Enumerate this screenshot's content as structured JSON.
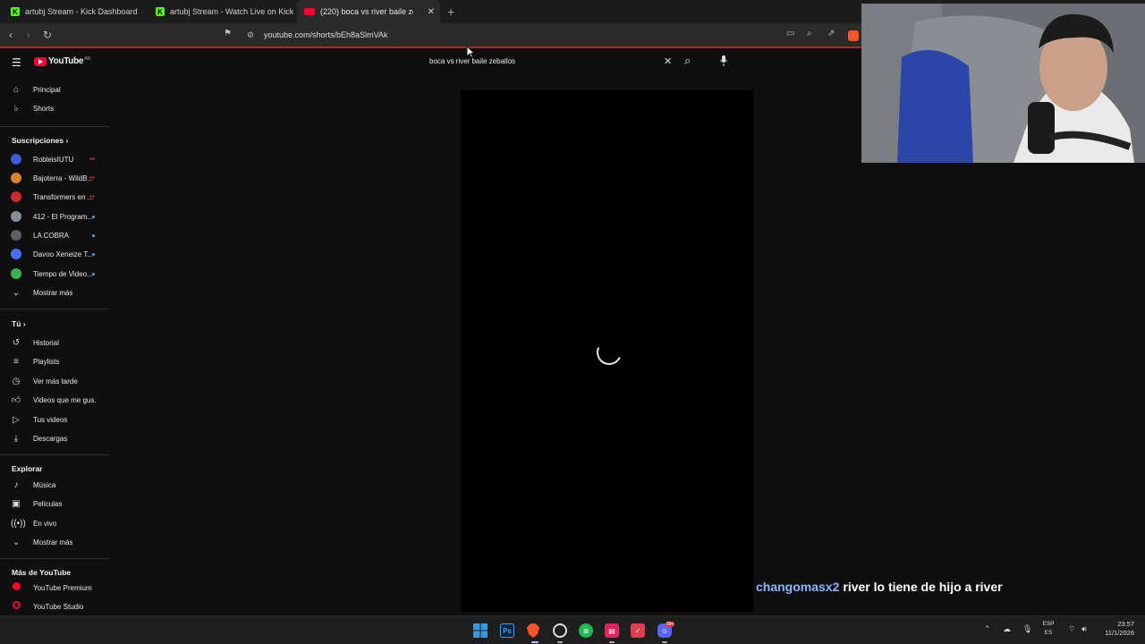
{
  "browser": {
    "tabs": [
      {
        "title": "artubj Stream - Kick Dashboard",
        "icon": "kick-icon"
      },
      {
        "title": "artubj Stream - Watch Live on Kick",
        "icon": "kick-icon"
      },
      {
        "title": "(220) boca vs river baile zeba",
        "icon": "youtube-icon",
        "active": true
      }
    ],
    "url": "youtube.com/shorts/bEh8aSlmVAk"
  },
  "youtube": {
    "logo": "YouTube",
    "country": "AR",
    "search_value": "boca vs river baile zeballos",
    "sidebar": {
      "main": [
        {
          "label": "Principal",
          "icon": "home-icon"
        },
        {
          "label": "Shorts",
          "icon": "shorts-icon"
        }
      ],
      "subscriptions_header": "Suscripciones",
      "subscriptions": [
        {
          "label": "RobleisIUTU",
          "color": "#3b5bdb",
          "status": "live"
        },
        {
          "label": "Bajoterra - WildB...",
          "color": "#d9822b",
          "status": "live"
        },
        {
          "label": "Transformers en ...",
          "color": "#c92a2a",
          "status": "live"
        },
        {
          "label": "412 - El Program...",
          "color": "#868e96",
          "status": "new"
        },
        {
          "label": "LA COBRA",
          "color": "#5c5f66",
          "status": "new"
        },
        {
          "label": "Davoo Xeneize T...",
          "color": "#4c6ef5",
          "status": "new"
        },
        {
          "label": "Tiempo de Video...",
          "color": "#37b24d",
          "status": "new"
        }
      ],
      "show_more_1": "Mostrar más",
      "you_header": "Tú",
      "you": [
        {
          "label": "Historial",
          "icon": "history-icon"
        },
        {
          "label": "Playlists",
          "icon": "playlists-icon"
        },
        {
          "label": "Ver más tarde",
          "icon": "clock-icon"
        },
        {
          "label": "Videos que me gus...",
          "icon": "like-icon"
        },
        {
          "label": "Tus videos",
          "icon": "your-videos-icon"
        },
        {
          "label": "Descargas",
          "icon": "download-icon"
        }
      ],
      "explore_header": "Explorar",
      "explore": [
        {
          "label": "Música",
          "icon": "music-icon"
        },
        {
          "label": "Películas",
          "icon": "movies-icon"
        },
        {
          "label": "En vivo",
          "icon": "live-icon"
        }
      ],
      "show_more_2": "Mostrar más",
      "more_header": "Más de YouTube",
      "more": [
        {
          "label": "YouTube Premium",
          "icon": "youtube-premium-icon"
        },
        {
          "label": "YouTube Studio",
          "icon": "youtube-studio-icon"
        }
      ]
    }
  },
  "chat_overlay": {
    "username": "changomasx2",
    "message": "river lo tiene de hijo a river"
  },
  "taskbar": {
    "language": "ESP",
    "layout": "ES",
    "time": "23:57",
    "date": "11/1/2026",
    "discord_badge": "99+"
  },
  "colors": {
    "youtube_red": "#ff0033",
    "kick_green": "#53fc18",
    "chat_user": "#8ab4ff"
  }
}
